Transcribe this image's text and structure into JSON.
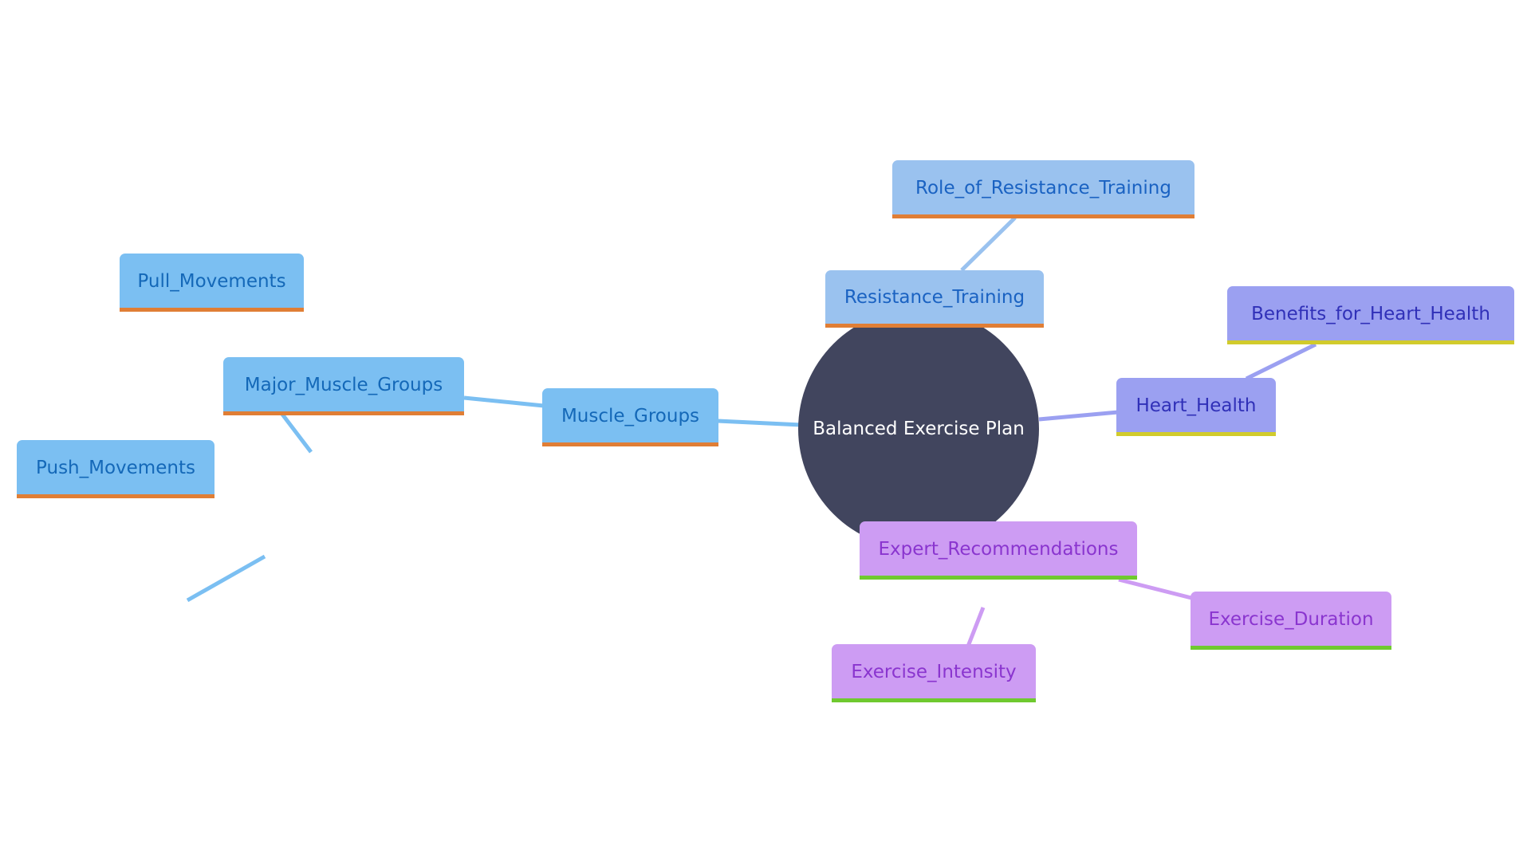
{
  "diagram": {
    "type": "mindmap",
    "root": {
      "label": "Balanced Exercise Plan",
      "color": "#41455e"
    },
    "branches": [
      {
        "label": "Muscle_Groups",
        "color": "#7bbff2",
        "children": [
          {
            "label": "Major_Muscle_Groups",
            "children": [
              {
                "label": "Pull_Movements"
              },
              {
                "label": "Push_Movements"
              }
            ]
          }
        ]
      },
      {
        "label": "Resistance_Training",
        "color": "#9ac2ef",
        "children": [
          {
            "label": "Role_of_Resistance_Training"
          }
        ]
      },
      {
        "label": "Heart_Health",
        "color": "#9ba0f1",
        "children": [
          {
            "label": "Benefits_for_Heart_Health"
          }
        ]
      },
      {
        "label": "Expert_Recommendations",
        "color": "#cd9cf3",
        "children": [
          {
            "label": "Exercise_Duration"
          },
          {
            "label": "Exercise_Intensity"
          }
        ]
      }
    ]
  },
  "labels": {
    "root": "Balanced Exercise Plan",
    "muscle_groups": "Muscle_Groups",
    "major_muscle_groups": "Major_Muscle_Groups",
    "pull_movements": "Pull_Movements",
    "push_movements": "Push_Movements",
    "resistance_training": "Resistance_Training",
    "role_of_resistance_training": "Role_of_Resistance_Training",
    "heart_health": "Heart_Health",
    "benefits_for_heart_health": "Benefits_for_Heart_Health",
    "expert_recommendations": "Expert_Recommendations",
    "exercise_duration": "Exercise_Duration",
    "exercise_intensity": "Exercise_Intensity"
  }
}
